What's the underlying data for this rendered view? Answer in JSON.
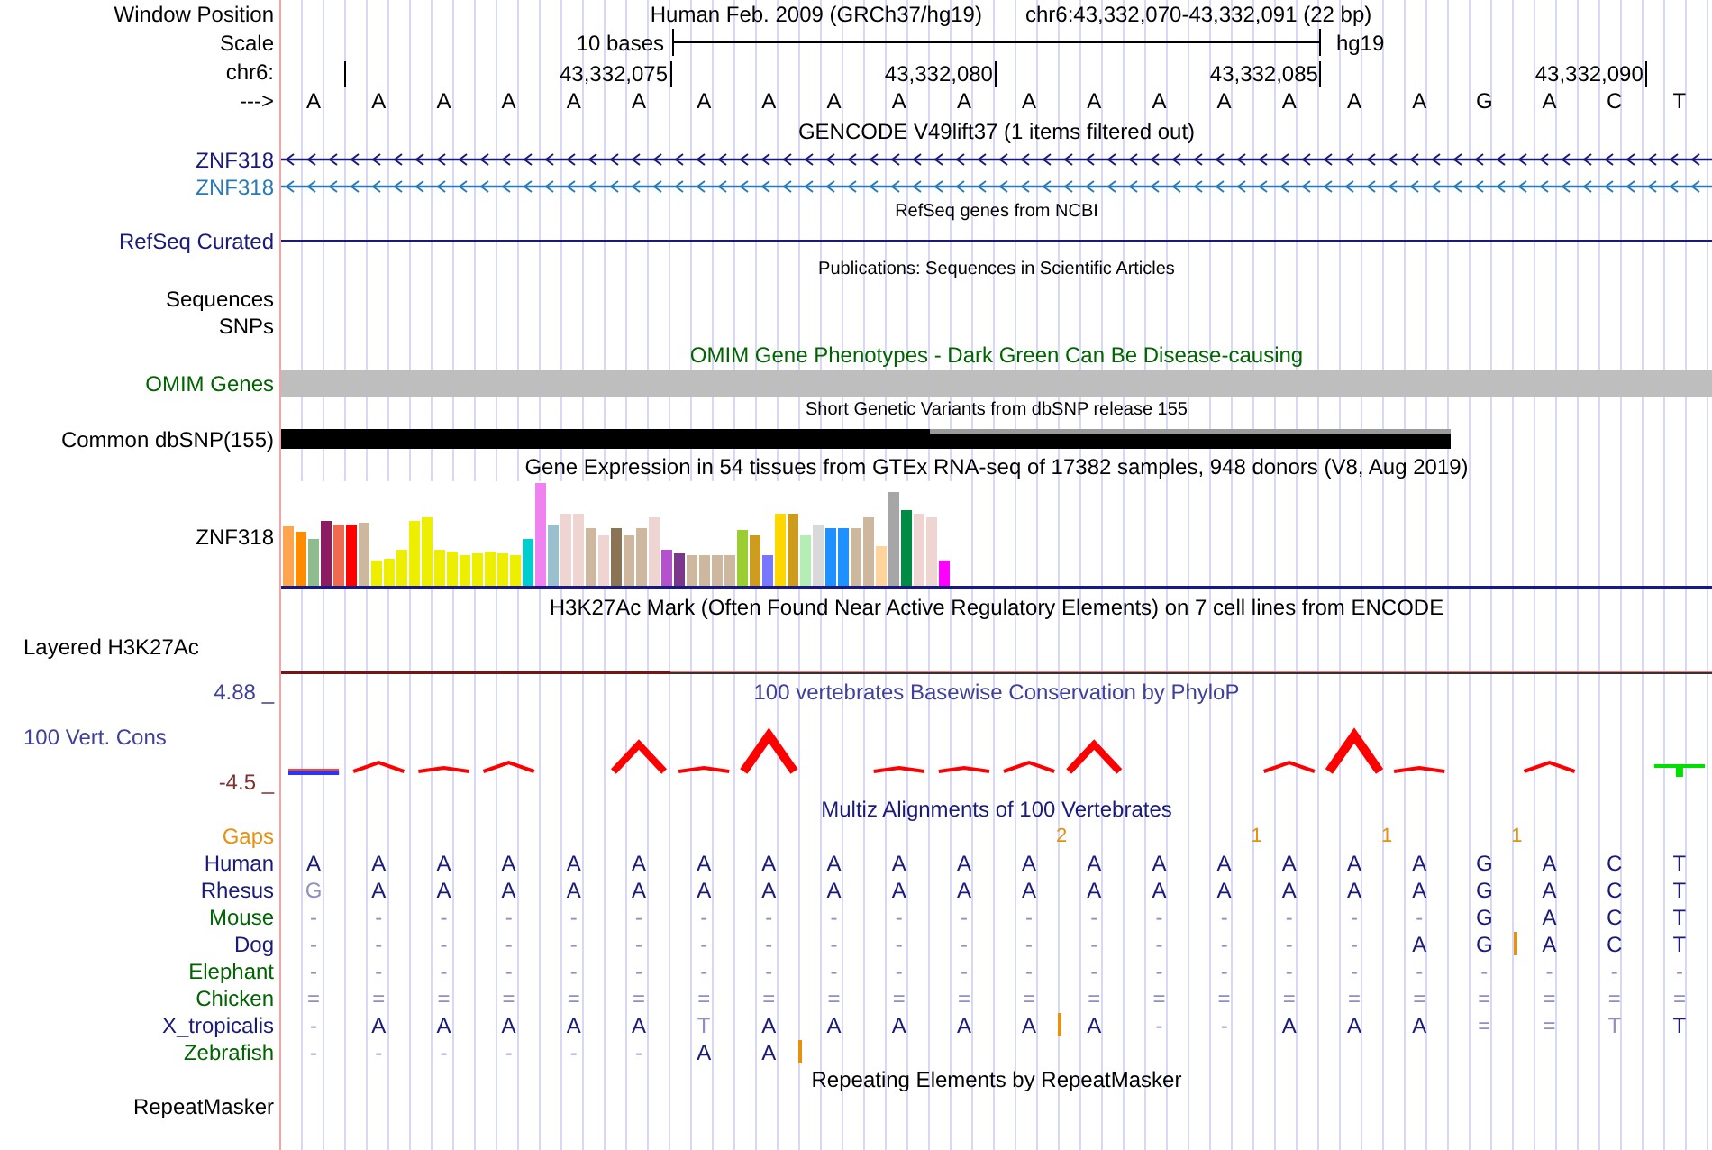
{
  "header": {
    "label": "Window Position",
    "assembly": "Human Feb. 2009 (GRCh37/hg19)",
    "position": "chr6:43,332,070-43,332,091 (22 bp)"
  },
  "scale": {
    "label": "Scale",
    "span": "10 bases",
    "assembly": "hg19"
  },
  "ruler": {
    "label": "chr6:",
    "tick_labels": [
      "43,332,075",
      "43,332,080",
      "43,332,085",
      "43,332,090"
    ]
  },
  "sequence": {
    "label": "--->",
    "bases": [
      "A",
      "A",
      "A",
      "A",
      "A",
      "A",
      "A",
      "A",
      "A",
      "A",
      "A",
      "A",
      "A",
      "A",
      "A",
      "A",
      "A",
      "A",
      "G",
      "A",
      "C",
      "T"
    ]
  },
  "tracks": [
    {
      "kind": "genes",
      "title": "GENCODE V49lift37 (1 items filtered out)",
      "items": [
        {
          "name": "ZNF318",
          "color": "#1a1a7a"
        },
        {
          "name": "ZNF318",
          "color": "#2a7ab8"
        }
      ]
    },
    {
      "kind": "line",
      "title": "RefSeq genes from NCBI",
      "label": "RefSeq Curated"
    },
    {
      "kind": "empty",
      "title": "Publications: Sequences in Scientific Articles",
      "labels": [
        "Sequences",
        "SNPs"
      ]
    },
    {
      "kind": "bar",
      "title": "OMIM Gene Phenotypes - Dark Green Can Be Disease-causing",
      "label": "OMIM Genes"
    },
    {
      "kind": "snp",
      "title": "Short Genetic Variants from dbSNP release 155",
      "label": "Common dbSNP(155)"
    },
    {
      "kind": "expression",
      "title": "Gene Expression in 54 tissues from GTEx RNA-seq of 17382 samples, 948 donors (V8, Aug 2019)",
      "label": "ZNF318"
    },
    {
      "kind": "signal",
      "title": "H3K27Ac Mark (Often Found Near Active Regulatory Elements) on 7 cell lines from ENCODE",
      "label": "Layered H3K27Ac"
    },
    {
      "kind": "conservation",
      "title": "100 vertebrates Basewise Conservation by PhyloP",
      "label": "100 Vert. Cons",
      "max": "4.88 _",
      "min": "-4.5 _"
    },
    {
      "kind": "alignment",
      "title": "Multiz Alignments of 100 Vertebrates",
      "gaps_label": "Gaps",
      "gaps": [
        {
          "gap": false
        },
        {
          "gap": false
        },
        {
          "gap": false
        },
        {
          "gap": false
        },
        {
          "gap": false
        },
        {
          "gap": false
        },
        {
          "gap": false
        },
        {
          "gap": false
        },
        {
          "gap": false
        },
        {
          "gap": false
        },
        {
          "gap": false
        },
        {
          "gap": true,
          "count": "2"
        },
        {
          "gap": false
        },
        {
          "gap": false
        },
        {
          "gap": true,
          "count": "1"
        },
        {
          "gap": false
        },
        {
          "gap": true,
          "count": "1"
        },
        {
          "gap": false
        },
        {
          "gap": true,
          "count": "1"
        },
        {
          "gap": false
        },
        {
          "gap": false
        },
        {
          "gap": false
        }
      ],
      "species": [
        {
          "name": "Human",
          "color": "#1a1a7a",
          "cells": [
            {
              "text": "A",
              "dim": false
            },
            {
              "text": "A",
              "dim": false
            },
            {
              "text": "A",
              "dim": false
            },
            {
              "text": "A",
              "dim": false
            },
            {
              "text": "A",
              "dim": false
            },
            {
              "text": "A",
              "dim": false
            },
            {
              "text": "A",
              "dim": false
            },
            {
              "text": "A",
              "dim": false
            },
            {
              "text": "A",
              "dim": false
            },
            {
              "text": "A",
              "dim": false
            },
            {
              "text": "A",
              "dim": false
            },
            {
              "text": "A",
              "dim": false
            },
            {
              "text": "A",
              "dim": false
            },
            {
              "text": "A",
              "dim": false
            },
            {
              "text": "A",
              "dim": false
            },
            {
              "text": "A",
              "dim": false
            },
            {
              "text": "A",
              "dim": false
            },
            {
              "text": "A",
              "dim": false
            },
            {
              "text": "G",
              "dim": false
            },
            {
              "text": "A",
              "dim": false
            },
            {
              "text": "C",
              "dim": false
            },
            {
              "text": "T",
              "dim": false
            }
          ]
        },
        {
          "name": "Rhesus",
          "color": "#1a1a7a",
          "cells": [
            {
              "text": "G",
              "dim": true
            },
            {
              "text": "A",
              "dim": false
            },
            {
              "text": "A",
              "dim": false
            },
            {
              "text": "A",
              "dim": false
            },
            {
              "text": "A",
              "dim": false
            },
            {
              "text": "A",
              "dim": false
            },
            {
              "text": "A",
              "dim": false
            },
            {
              "text": "A",
              "dim": false
            },
            {
              "text": "A",
              "dim": false
            },
            {
              "text": "A",
              "dim": false
            },
            {
              "text": "A",
              "dim": false
            },
            {
              "text": "A",
              "dim": false
            },
            {
              "text": "A",
              "dim": false
            },
            {
              "text": "A",
              "dim": false
            },
            {
              "text": "A",
              "dim": false
            },
            {
              "text": "A",
              "dim": false
            },
            {
              "text": "A",
              "dim": false
            },
            {
              "text": "A",
              "dim": false
            },
            {
              "text": "G",
              "dim": false
            },
            {
              "text": "A",
              "dim": false
            },
            {
              "text": "C",
              "dim": false
            },
            {
              "text": "T",
              "dim": false
            }
          ]
        },
        {
          "name": "Mouse",
          "color": "#006400",
          "cells": [
            {
              "text": "-",
              "dim": true
            },
            {
              "text": "-",
              "dim": true
            },
            {
              "text": "-",
              "dim": true
            },
            {
              "text": "-",
              "dim": true
            },
            {
              "text": "-",
              "dim": true
            },
            {
              "text": "-",
              "dim": true
            },
            {
              "text": "-",
              "dim": true
            },
            {
              "text": "-",
              "dim": true
            },
            {
              "text": "-",
              "dim": true
            },
            {
              "text": "-",
              "dim": true
            },
            {
              "text": "-",
              "dim": true
            },
            {
              "text": "-",
              "dim": true
            },
            {
              "text": "-",
              "dim": true
            },
            {
              "text": "-",
              "dim": true
            },
            {
              "text": "-",
              "dim": true
            },
            {
              "text": "-",
              "dim": true
            },
            {
              "text": "-",
              "dim": true
            },
            {
              "text": "-",
              "dim": true
            },
            {
              "text": "G",
              "dim": false
            },
            {
              "text": "A",
              "dim": false
            },
            {
              "text": "C",
              "dim": false
            },
            {
              "text": "T",
              "dim": false
            }
          ]
        },
        {
          "name": "Dog",
          "color": "#1a1a7a",
          "cells": [
            {
              "text": "-",
              "dim": true
            },
            {
              "text": "-",
              "dim": true
            },
            {
              "text": "-",
              "dim": true
            },
            {
              "text": "-",
              "dim": true
            },
            {
              "text": "-",
              "dim": true
            },
            {
              "text": "-",
              "dim": true
            },
            {
              "text": "-",
              "dim": true
            },
            {
              "text": "-",
              "dim": true
            },
            {
              "text": "-",
              "dim": true
            },
            {
              "text": "-",
              "dim": true
            },
            {
              "text": "-",
              "dim": true
            },
            {
              "text": "-",
              "dim": true
            },
            {
              "text": "-",
              "dim": true
            },
            {
              "text": "-",
              "dim": true
            },
            {
              "text": "-",
              "dim": true
            },
            {
              "text": "-",
              "dim": true
            },
            {
              "text": "-",
              "dim": true
            },
            {
              "text": "A",
              "dim": false
            },
            {
              "text": "G",
              "dim": false,
              "insert": true
            },
            {
              "text": "A",
              "dim": false
            },
            {
              "text": "C",
              "dim": false
            },
            {
              "text": "T",
              "dim": false
            }
          ]
        },
        {
          "name": "Elephant",
          "color": "#006400",
          "cells": [
            {
              "text": "-",
              "dim": true
            },
            {
              "text": "-",
              "dim": true
            },
            {
              "text": "-",
              "dim": true
            },
            {
              "text": "-",
              "dim": true
            },
            {
              "text": "-",
              "dim": true
            },
            {
              "text": "-",
              "dim": true
            },
            {
              "text": "-",
              "dim": true
            },
            {
              "text": "-",
              "dim": true
            },
            {
              "text": "-",
              "dim": true
            },
            {
              "text": "-",
              "dim": true
            },
            {
              "text": "-",
              "dim": true
            },
            {
              "text": "-",
              "dim": true
            },
            {
              "text": "-",
              "dim": true
            },
            {
              "text": "-",
              "dim": true
            },
            {
              "text": "-",
              "dim": true
            },
            {
              "text": "-",
              "dim": true
            },
            {
              "text": "-",
              "dim": true
            },
            {
              "text": "-",
              "dim": true
            },
            {
              "text": "-",
              "dim": true
            },
            {
              "text": "-",
              "dim": true
            },
            {
              "text": "-",
              "dim": true
            },
            {
              "text": "-",
              "dim": true
            }
          ]
        },
        {
          "name": "Chicken",
          "color": "#006400",
          "cells": [
            {
              "text": "=",
              "dim": true
            },
            {
              "text": "=",
              "dim": true
            },
            {
              "text": "=",
              "dim": true
            },
            {
              "text": "=",
              "dim": true
            },
            {
              "text": "=",
              "dim": true
            },
            {
              "text": "=",
              "dim": true
            },
            {
              "text": "=",
              "dim": true
            },
            {
              "text": "=",
              "dim": true
            },
            {
              "text": "=",
              "dim": true
            },
            {
              "text": "=",
              "dim": true
            },
            {
              "text": "=",
              "dim": true
            },
            {
              "text": "=",
              "dim": true
            },
            {
              "text": "=",
              "dim": true
            },
            {
              "text": "=",
              "dim": true
            },
            {
              "text": "=",
              "dim": true
            },
            {
              "text": "=",
              "dim": true
            },
            {
              "text": "=",
              "dim": true
            },
            {
              "text": "=",
              "dim": true
            },
            {
              "text": "=",
              "dim": true
            },
            {
              "text": "=",
              "dim": true
            },
            {
              "text": "=",
              "dim": true
            },
            {
              "text": "=",
              "dim": true
            }
          ]
        },
        {
          "name": "X_tropicalis",
          "color": "#1a1a7a",
          "cells": [
            {
              "text": "-",
              "dim": true
            },
            {
              "text": "A",
              "dim": false
            },
            {
              "text": "A",
              "dim": false
            },
            {
              "text": "A",
              "dim": false
            },
            {
              "text": "A",
              "dim": false
            },
            {
              "text": "A",
              "dim": false
            },
            {
              "text": "T",
              "dim": true
            },
            {
              "text": "A",
              "dim": false
            },
            {
              "text": "A",
              "dim": false
            },
            {
              "text": "A",
              "dim": false
            },
            {
              "text": "A",
              "dim": false
            },
            {
              "text": "A",
              "dim": false,
              "insert": true
            },
            {
              "text": "A",
              "dim": false
            },
            {
              "text": "-",
              "dim": true
            },
            {
              "text": "-",
              "dim": true
            },
            {
              "text": "A",
              "dim": false
            },
            {
              "text": "A",
              "dim": false
            },
            {
              "text": "A",
              "dim": false
            },
            {
              "text": "=",
              "dim": true
            },
            {
              "text": "=",
              "dim": true
            },
            {
              "text": "T",
              "dim": true
            },
            {
              "text": "T",
              "dim": false
            }
          ]
        },
        {
          "name": "Zebrafish",
          "color": "#006400",
          "cells": [
            {
              "text": "-",
              "dim": true
            },
            {
              "text": "-",
              "dim": true
            },
            {
              "text": "-",
              "dim": true
            },
            {
              "text": "-",
              "dim": true
            },
            {
              "text": "-",
              "dim": true
            },
            {
              "text": "-",
              "dim": true
            },
            {
              "text": "A",
              "dim": false
            },
            {
              "text": "A",
              "dim": false,
              "insert": true
            }
          ]
        }
      ]
    },
    {
      "kind": "repeats",
      "title": "Repeating Elements by RepeatMasker",
      "label": "RepeatMasker"
    }
  ]
}
